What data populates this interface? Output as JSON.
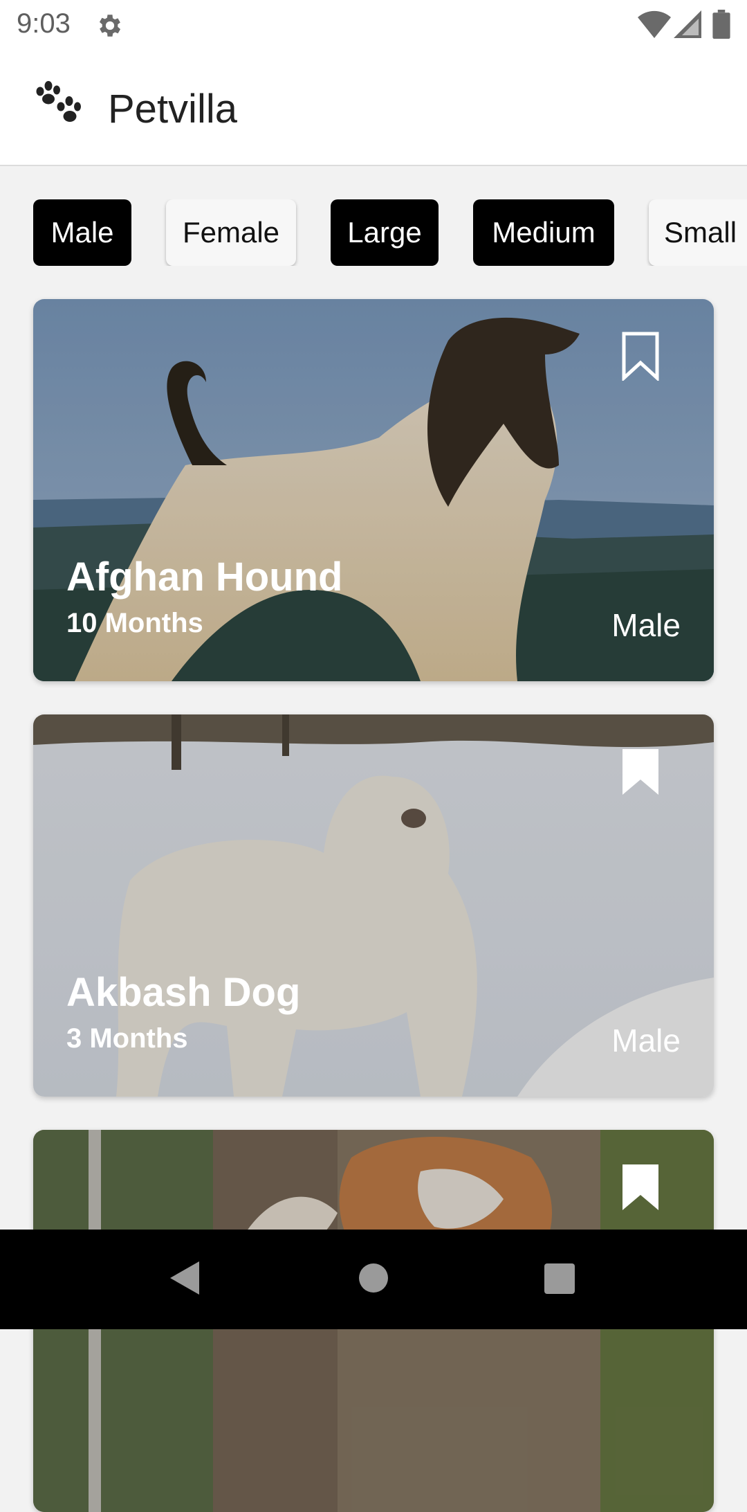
{
  "status_bar": {
    "time": "9:03",
    "icons": [
      "gear-icon",
      "wifi-icon",
      "cellular-signal-icon",
      "battery-icon"
    ]
  },
  "app_bar": {
    "logo_icon": "paw-icon",
    "title": "Petvilla"
  },
  "filters": [
    {
      "label": "Male",
      "selected": true
    },
    {
      "label": "Female",
      "selected": false
    },
    {
      "label": "Large",
      "selected": true
    },
    {
      "label": "Medium",
      "selected": true
    },
    {
      "label": "Small",
      "selected": false
    }
  ],
  "pets": [
    {
      "name": "Afghan Hound",
      "age": "10 Months",
      "gender": "Male",
      "bookmark_icon": "bookmark-outline-icon",
      "bookmarked": false
    },
    {
      "name": "Akbash Dog",
      "age": "3 Months",
      "gender": "Male",
      "bookmark_icon": "bookmark-filled-icon",
      "bookmarked": true
    },
    {
      "name": "",
      "age": "",
      "gender": "",
      "bookmark_icon": "bookmark-filled-icon",
      "bookmarked": true
    }
  ],
  "nav_bar": {
    "icons": [
      "back-icon",
      "home-icon",
      "recents-icon"
    ]
  },
  "colors": {
    "chip_selected": "#000000",
    "chip_unselected": "#f7f7f7",
    "background": "#f2f2f2",
    "nav_bar": "#000000"
  }
}
